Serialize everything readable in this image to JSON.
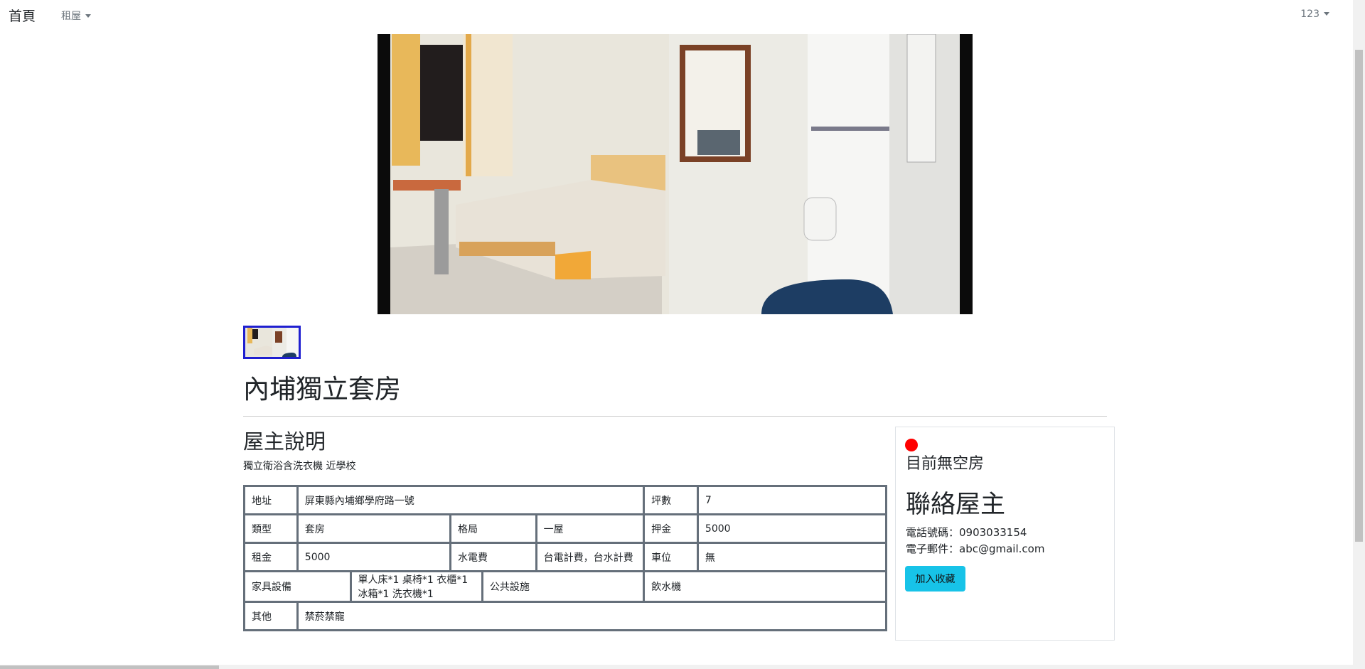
{
  "navbar": {
    "brand": "首頁",
    "rent_menu": "租屋",
    "user_menu": "123"
  },
  "gallery": {
    "main_photo": "room-photo",
    "thumbnails": [
      "room-photo-thumbnail"
    ]
  },
  "listing": {
    "title": "內埔獨立套房",
    "owner_section": "屋主說明",
    "description": "獨立衛浴含洗衣機 近學校"
  },
  "details": {
    "address_label": "地址",
    "address_value": "屏東縣內埔鄉學府路一號",
    "area_label": "坪數",
    "area_value": "7",
    "type_label": "類型",
    "type_value": "套房",
    "layout_label": "格局",
    "layout_value": "一屋",
    "deposit_label": "押金",
    "deposit_value": "5000",
    "rent_label": "租金",
    "rent_value": "5000",
    "utility_label": "水電費",
    "utility_value": "台電計費，台水計費",
    "parking_label": "車位",
    "parking_value": "無",
    "furniture_label": "家具設備",
    "furniture_value": "單人床*1 桌椅*1 衣櫃*1 冰箱*1 洗衣機*1",
    "facility_label": "公共設施",
    "facility_value": "飲水機",
    "other_label": "其他",
    "other_value": "禁菸禁寵"
  },
  "sidebar": {
    "status_color": "#ff0000",
    "status_text": "目前無空房",
    "contact_title": "聯絡屋主",
    "phone": "電話號碼：0903033154",
    "email": "電子郵件：abc@gmail.com",
    "favorite_button": "加入收藏"
  },
  "colors": {
    "button": "#17c3e8",
    "thumbnail_border": "#1f1fd0",
    "table_border": "#656f7a"
  }
}
